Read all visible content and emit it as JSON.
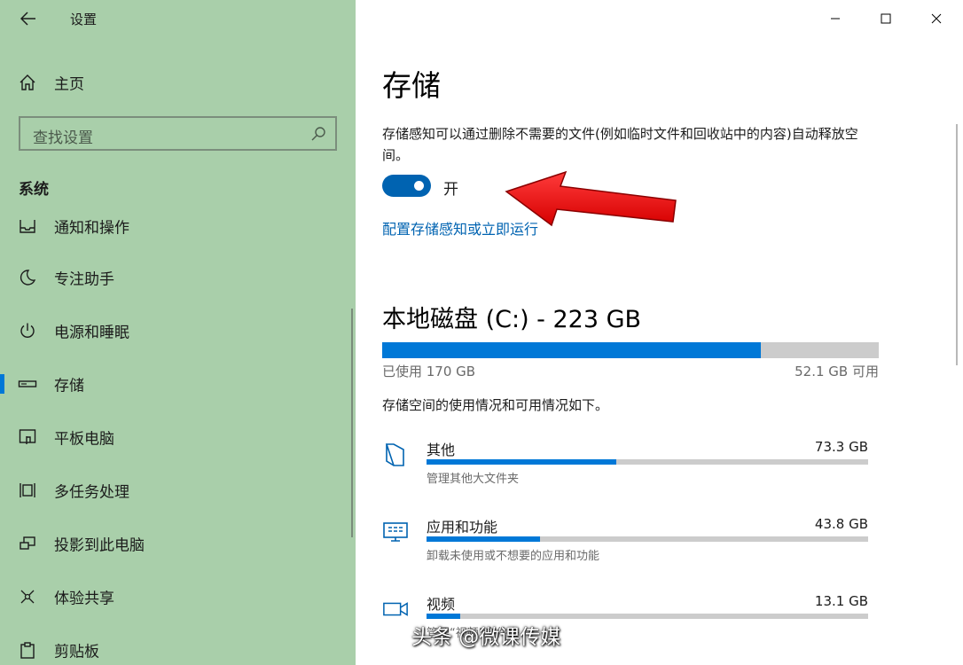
{
  "app": {
    "title": "设置"
  },
  "window": {
    "minimize": "minimize",
    "maximize": "maximize",
    "close": "close"
  },
  "sidebar": {
    "home_label": "主页",
    "search_placeholder": "查找设置",
    "section": "系统",
    "items": [
      {
        "label": "通知和操作",
        "icon": "notification-icon"
      },
      {
        "label": "专注助手",
        "icon": "moon-icon"
      },
      {
        "label": "电源和睡眠",
        "icon": "power-icon"
      },
      {
        "label": "存储",
        "icon": "storage-icon",
        "active": true
      },
      {
        "label": "平板电脑",
        "icon": "tablet-icon"
      },
      {
        "label": "多任务处理",
        "icon": "multitask-icon"
      },
      {
        "label": "投影到此电脑",
        "icon": "project-icon"
      },
      {
        "label": "体验共享",
        "icon": "share-icon"
      },
      {
        "label": "剪贴板",
        "icon": "clipboard-icon"
      }
    ]
  },
  "main": {
    "title": "存储",
    "description": "存储感知可以通过删除不需要的文件(例如临时文件和回收站中的内容)自动释放空间。",
    "toggle": {
      "state": "开",
      "on": true
    },
    "config_link": "配置存储感知或立即运行",
    "disk": {
      "title": "本地磁盘 (C:) - 223 GB",
      "used_label": "已使用 170 GB",
      "free_label": "52.1 GB 可用",
      "used_fraction": 0.762
    },
    "usage_description": "存储空间的使用情况和可用情况如下。",
    "categories": [
      {
        "name": "其他",
        "size": "73.3 GB",
        "sub": "管理其他大文件夹",
        "fraction": 0.43,
        "icon": "folder-icon"
      },
      {
        "name": "应用和功能",
        "size": "43.8 GB",
        "sub": "卸载未使用或不想要的应用和功能",
        "fraction": 0.257,
        "icon": "apps-icon"
      },
      {
        "name": "视频",
        "size": "13.1 GB",
        "sub": "管理“视频”文件夹",
        "fraction": 0.077,
        "icon": "video-icon"
      }
    ]
  },
  "accent_color": "#0078d7",
  "annotation_arrow_color": "#ff1111",
  "watermark": "头条 @微课传媒"
}
